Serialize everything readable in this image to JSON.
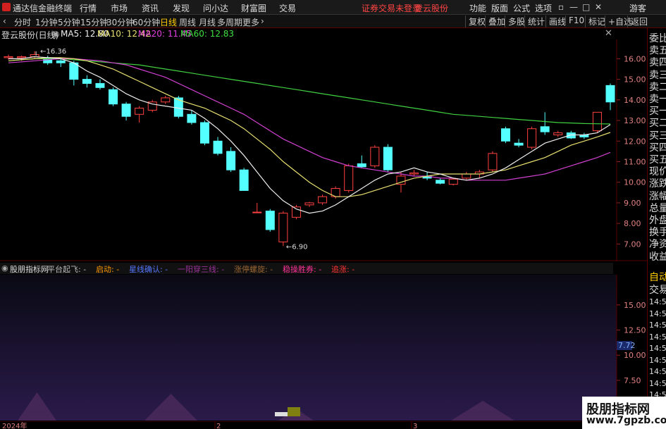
{
  "menubar": {
    "app_name": "通达信金融终端",
    "items": [
      "行情",
      "市场",
      "资讯",
      "发现",
      "问小达",
      "财富圈",
      "交易"
    ],
    "notice_left": "证券交易未登录",
    "notice_right": "登云股份",
    "right_items": [
      "功能",
      "版面",
      "公式",
      "选项"
    ],
    "guest": "游客"
  },
  "toolbar": {
    "periods": [
      "分时",
      "1分钟",
      "5分钟",
      "15分钟",
      "30分钟",
      "60分钟",
      "日线",
      "周线",
      "月线",
      "多周期",
      "更多"
    ],
    "active_period": "日线",
    "right_buttons": [
      "复权",
      "叠加",
      "多股",
      "统计",
      "画线",
      "F10",
      "标记",
      "+自选",
      "返回"
    ]
  },
  "main_chart": {
    "title": "登云股份(日线)",
    "ma5": "MA5: 12.80",
    "ma10": "MA10: 12.42",
    "ma20": "MA20: 11.45",
    "ma60": "MA60: 12.83",
    "high_label": "16.36",
    "low_label": "6.90",
    "y_ticks": [
      "16.00",
      "15.00",
      "14.00",
      "13.00",
      "12.00",
      "11.00",
      "10.00",
      "9.00",
      "8.00",
      "7.00"
    ]
  },
  "indicator": {
    "title": "股朋指标网",
    "items": [
      {
        "label": "平台起飞:",
        "color": "#bbbbbb"
      },
      {
        "label": "启动:",
        "color": "#ff9900"
      },
      {
        "label": "星线确认:",
        "color": "#5577ff"
      },
      {
        "label": "一阳穿三线:",
        "color": "#993399"
      },
      {
        "label": "涨停螺旋:",
        "color": "#996633"
      },
      {
        "label": "稳操胜券:",
        "color": "#ff3399"
      },
      {
        "label": "追涨:",
        "color": "#ff3333"
      }
    ],
    "y_ticks": [
      "15.00",
      "12.50",
      "10.00",
      "7.50",
      "5.00"
    ],
    "current_value": "7.72"
  },
  "time_axis": [
    "2024年",
    "2",
    "3"
  ],
  "right_panel": {
    "labels": [
      "委比",
      "卖五",
      "卖四",
      "卖三",
      "卖二",
      "卖一",
      "买一",
      "买二",
      "买三",
      "买四",
      "买五",
      "现价",
      "涨跌",
      "涨幅",
      "总量",
      "外盘",
      "换手",
      "净资",
      "收益"
    ],
    "tabs": [
      "自动",
      "交易"
    ],
    "times": [
      "14:55",
      "14:56",
      "14:56",
      "14:56",
      "14:56",
      "14:56",
      "14:56",
      "14:56",
      "14:56",
      "14:56",
      "14:56"
    ]
  },
  "watermark": {
    "line1": "股朋指标网",
    "line2": "www.7gpzb.com"
  },
  "chart_data": {
    "type": "candlestick",
    "candles": [
      {
        "o": 16.05,
        "h": 16.2,
        "l": 15.95,
        "c": 16.1
      },
      {
        "o": 16.05,
        "h": 16.15,
        "l": 15.9,
        "c": 16.1
      },
      {
        "o": 16.1,
        "h": 16.36,
        "l": 16.0,
        "c": 16.2
      },
      {
        "o": 16.05,
        "h": 16.15,
        "l": 15.7,
        "c": 15.8
      },
      {
        "o": 15.9,
        "h": 16.0,
        "l": 15.6,
        "c": 15.8
      },
      {
        "o": 15.8,
        "h": 15.9,
        "l": 14.7,
        "c": 15.0
      },
      {
        "o": 15.0,
        "h": 15.2,
        "l": 14.6,
        "c": 14.8
      },
      {
        "o": 14.8,
        "h": 15.0,
        "l": 14.5,
        "c": 14.6
      },
      {
        "o": 14.5,
        "h": 14.6,
        "l": 13.7,
        "c": 13.8
      },
      {
        "o": 13.8,
        "h": 13.9,
        "l": 13.0,
        "c": 13.2
      },
      {
        "o": 13.3,
        "h": 13.7,
        "l": 12.9,
        "c": 13.6
      },
      {
        "o": 13.5,
        "h": 14.0,
        "l": 13.4,
        "c": 13.9
      },
      {
        "o": 13.9,
        "h": 14.2,
        "l": 13.8,
        "c": 14.1
      },
      {
        "o": 14.1,
        "h": 14.2,
        "l": 13.1,
        "c": 13.2
      },
      {
        "o": 13.3,
        "h": 13.5,
        "l": 12.8,
        "c": 12.9
      },
      {
        "o": 12.9,
        "h": 13.0,
        "l": 11.8,
        "c": 11.9
      },
      {
        "o": 12.0,
        "h": 12.2,
        "l": 11.3,
        "c": 11.4
      },
      {
        "o": 11.5,
        "h": 11.7,
        "l": 10.5,
        "c": 10.6
      },
      {
        "o": 10.6,
        "h": 10.7,
        "l": 9.6,
        "c": 9.6
      },
      {
        "o": 8.55,
        "h": 9.0,
        "l": 8.5,
        "c": 8.55
      },
      {
        "o": 8.6,
        "h": 8.7,
        "l": 7.6,
        "c": 7.7
      },
      {
        "o": 7.1,
        "h": 8.6,
        "l": 6.9,
        "c": 8.5
      },
      {
        "o": 8.3,
        "h": 8.9,
        "l": 8.2,
        "c": 8.8
      },
      {
        "o": 8.9,
        "h": 9.05,
        "l": 8.8,
        "c": 9.0
      },
      {
        "o": 9.0,
        "h": 9.4,
        "l": 8.9,
        "c": 9.3
      },
      {
        "o": 9.3,
        "h": 9.8,
        "l": 9.2,
        "c": 9.7
      },
      {
        "o": 9.6,
        "h": 10.9,
        "l": 9.5,
        "c": 10.8
      },
      {
        "o": 10.9,
        "h": 11.3,
        "l": 10.7,
        "c": 10.75
      },
      {
        "o": 10.8,
        "h": 11.8,
        "l": 10.7,
        "c": 11.7
      },
      {
        "o": 11.7,
        "h": 11.85,
        "l": 10.5,
        "c": 10.6
      },
      {
        "o": 9.9,
        "h": 10.5,
        "l": 9.5,
        "c": 10.3
      },
      {
        "o": 10.4,
        "h": 10.6,
        "l": 10.3,
        "c": 10.45
      },
      {
        "o": 10.3,
        "h": 10.5,
        "l": 10.1,
        "c": 10.2
      },
      {
        "o": 10.1,
        "h": 10.2,
        "l": 9.9,
        "c": 9.95
      },
      {
        "o": 9.9,
        "h": 10.2,
        "l": 9.85,
        "c": 10.15
      },
      {
        "o": 10.2,
        "h": 10.5,
        "l": 10.1,
        "c": 10.4
      },
      {
        "o": 10.4,
        "h": 10.6,
        "l": 10.2,
        "c": 10.5
      },
      {
        "o": 10.6,
        "h": 11.5,
        "l": 10.5,
        "c": 11.4
      },
      {
        "o": 12.6,
        "h": 12.7,
        "l": 11.9,
        "c": 12.0
      },
      {
        "o": 11.9,
        "h": 12.1,
        "l": 11.7,
        "c": 11.8
      },
      {
        "o": 11.7,
        "h": 12.7,
        "l": 11.6,
        "c": 12.6
      },
      {
        "o": 12.7,
        "h": 13.4,
        "l": 12.3,
        "c": 12.45
      },
      {
        "o": 12.3,
        "h": 12.5,
        "l": 12.2,
        "c": 12.4
      },
      {
        "o": 12.4,
        "h": 12.5,
        "l": 12.1,
        "c": 12.15
      },
      {
        "o": 12.3,
        "h": 12.4,
        "l": 12.1,
        "c": 12.2
      },
      {
        "o": 12.5,
        "h": 13.4,
        "l": 12.4,
        "c": 13.4
      },
      {
        "o": 14.7,
        "h": 14.8,
        "l": 13.5,
        "c": 13.9
      }
    ],
    "ma5": [
      16.0,
      16.0,
      16.1,
      16.05,
      16.0,
      15.8,
      15.4,
      15.1,
      14.7,
      14.3,
      14.0,
      13.8,
      13.7,
      13.6,
      13.5,
      13.1,
      12.6,
      12.0,
      11.3,
      10.5,
      9.7,
      9.1,
      8.7,
      8.5,
      8.6,
      8.9,
      9.3,
      9.7,
      10.1,
      10.4,
      10.5,
      10.7,
      10.5,
      10.4,
      10.2,
      10.1,
      10.2,
      10.4,
      10.7,
      11.1,
      11.5,
      11.9,
      12.1,
      12.3,
      12.3,
      12.4,
      12.8
    ],
    "ma10": [
      15.9,
      15.95,
      16.0,
      16.05,
      16.05,
      16.0,
      15.9,
      15.7,
      15.5,
      15.2,
      14.9,
      14.6,
      14.3,
      14.0,
      13.8,
      13.6,
      13.3,
      13.0,
      12.6,
      12.1,
      11.6,
      11.0,
      10.5,
      10.0,
      9.6,
      9.3,
      9.3,
      9.4,
      9.6,
      9.8,
      10.0,
      10.2,
      10.3,
      10.4,
      10.4,
      10.4,
      10.4,
      10.5,
      10.6,
      10.8,
      11.0,
      11.2,
      11.5,
      11.8,
      12.0,
      12.2,
      12.42
    ],
    "ma20": [
      15.8,
      15.85,
      15.9,
      15.95,
      16.0,
      16.0,
      15.95,
      15.9,
      15.8,
      15.7,
      15.5,
      15.3,
      15.1,
      14.8,
      14.5,
      14.2,
      13.9,
      13.6,
      13.3,
      12.9,
      12.5,
      12.1,
      11.8,
      11.5,
      11.2,
      11.0,
      10.8,
      10.7,
      10.6,
      10.5,
      10.4,
      10.3,
      10.3,
      10.2,
      10.2,
      10.1,
      10.1,
      10.1,
      10.1,
      10.2,
      10.3,
      10.4,
      10.6,
      10.8,
      11.0,
      11.2,
      11.45
    ],
    "ma60": [
      15.9,
      15.95,
      16.0,
      16.0,
      16.0,
      15.95,
      15.9,
      15.85,
      15.8,
      15.75,
      15.7,
      15.6,
      15.5,
      15.4,
      15.3,
      15.2,
      15.1,
      15.0,
      14.9,
      14.8,
      14.7,
      14.6,
      14.5,
      14.4,
      14.3,
      14.2,
      14.1,
      14.0,
      13.9,
      13.8,
      13.7,
      13.6,
      13.5,
      13.4,
      13.3,
      13.25,
      13.2,
      13.15,
      13.1,
      13.05,
      13.0,
      12.95,
      12.9,
      12.88,
      12.85,
      12.84,
      12.83
    ],
    "ylim": [
      6.5,
      16.8
    ],
    "volume_like": [
      0,
      0,
      0,
      0,
      0,
      0,
      0,
      0,
      0,
      0,
      0,
      0,
      0,
      0,
      0,
      0,
      0,
      0,
      0,
      0,
      0,
      0,
      0,
      0,
      0,
      0,
      0,
      0,
      0,
      0,
      0,
      0,
      0,
      0,
      0,
      0,
      0,
      0,
      0,
      0,
      0,
      0,
      0,
      0,
      0,
      0,
      0
    ]
  }
}
